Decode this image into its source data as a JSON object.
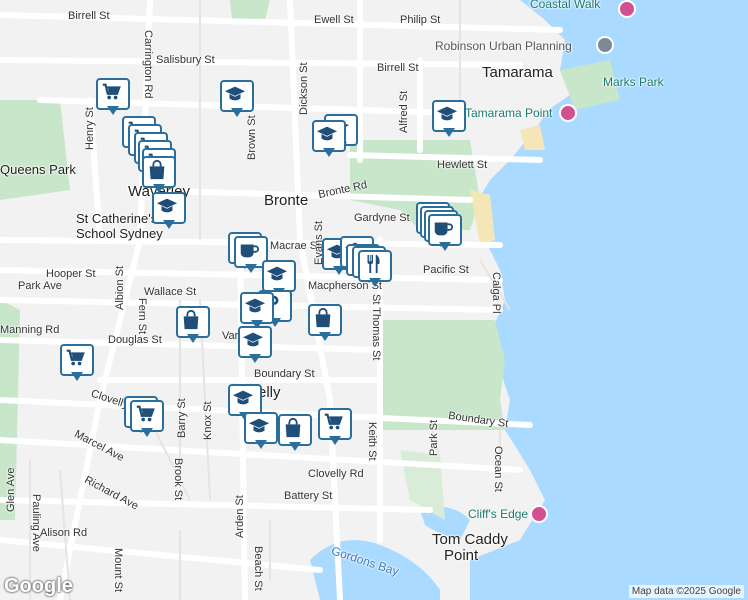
{
  "map": {
    "attribution": "Map data ©2025 Google",
    "logo": "Google",
    "colors": {
      "land": "#f2f2f2",
      "water": "#aadaff",
      "park": "#c8e6c9",
      "road": "#ffffff",
      "pin_border": "#2a6f9c",
      "poi": "#d2508f"
    }
  },
  "places": {
    "bronte": "Bronte",
    "tamarama": "Tamarama",
    "waverley": "Waverley",
    "clovelly": "Clovelly",
    "st_catherines_1": "St Catherine's",
    "st_catherines_2": "School Sydney",
    "queens_park": "Queens Park",
    "tom_caddy_1": "Tom Caddy",
    "tom_caddy_2": "Point",
    "gordons_bay": "Gordons Bay"
  },
  "pois": {
    "coastal_walk": "Coastal Walk",
    "robinson": "Robinson Urban Planning",
    "marks_park": "Marks Park",
    "tamarama_point": "Tamarama Point",
    "cliffs_edge": "Cliff's Edge"
  },
  "streets": {
    "birrell_top": "Birrell St",
    "ewell": "Ewell St",
    "philip": "Philip St",
    "birrell": "Birrell St",
    "salisbury": "Salisbury St",
    "carrington": "Carrington Rd",
    "dickson": "Dickson St",
    "alfred": "Alfred St",
    "hewlett": "Hewlett St",
    "henry": "Henry St",
    "brown": "Brown St",
    "bronte_rd": "Bronte Rd",
    "gardyne": "Gardyne St",
    "macrae": "Macrae St",
    "evans": "Evans St",
    "pacific": "Pacific St",
    "hooper": "Hooper St",
    "albion": "Albion St",
    "macpherson": "Macpherson St",
    "calga": "Calga Pl",
    "fern": "Fern St",
    "wallace": "Wallace St",
    "douglas": "Douglas St",
    "st_thomas": "St Thomas St",
    "boundary": "Boundary St",
    "boundary_e": "Boundary St",
    "barry": "Barry St",
    "knox": "Knox St",
    "clovelly_rd": "Clovelly Rd",
    "clovelly_rd2": "Clovelly Rd",
    "marcel": "Marcel Ave",
    "brook": "Brook St",
    "keith": "Keith St",
    "park": "Park St",
    "ocean": "Ocean St",
    "glen": "Glen Ave",
    "pauling": "Pauling Ave",
    "richard": "Richard Ave",
    "arden": "Arden St",
    "battery": "Battery St",
    "beach": "Beach St",
    "alison": "Alison Rd",
    "mount": "Mount St",
    "varna": "Varna St",
    "park_ave": "Park Ave",
    "manning": "Manning Rd"
  }
}
